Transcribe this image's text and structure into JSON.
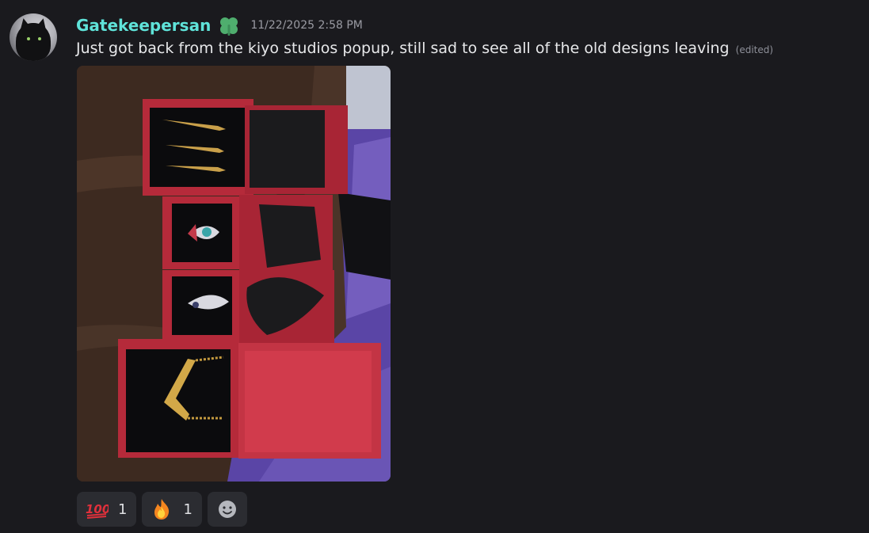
{
  "message": {
    "author": "Gatekeepersan",
    "author_color": "#5fe3d9",
    "role_icon": "clover-icon",
    "timestamp": "11/22/2025 2:58 PM",
    "text": "Just got back from the kiyo studios popup, still sad to see all of the old designs leaving",
    "edited_label": "(edited)",
    "avatar_icon": "black-cat-avatar"
  },
  "attachment": {
    "kind": "photo",
    "subject": "jewelry-boxes-photo"
  },
  "reactions": [
    {
      "emoji": "hundred-points-icon",
      "count": "1"
    },
    {
      "emoji": "fire-icon",
      "count": "1"
    }
  ],
  "add_reaction": {
    "icon": "smiley-add-reaction-icon"
  }
}
